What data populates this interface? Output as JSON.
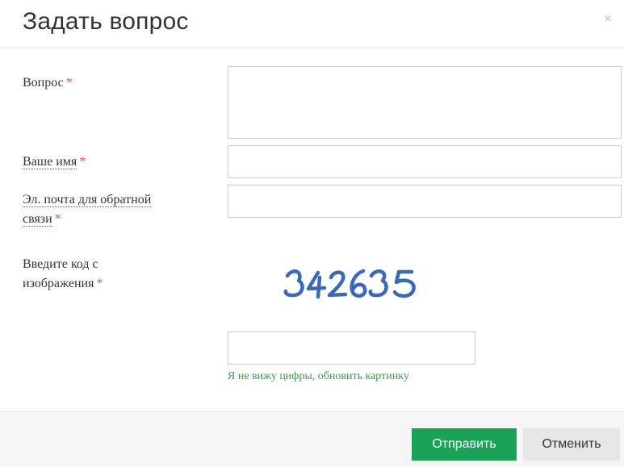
{
  "modal": {
    "title": "Задать вопрос",
    "close_icon": "×"
  },
  "form": {
    "question": {
      "label": "Вопрос",
      "required_mark": "*",
      "value": ""
    },
    "name": {
      "label": "Ваше имя",
      "required_mark": "*",
      "value": ""
    },
    "email": {
      "label_line1": "Эл. почта для обратной",
      "label_line2": "связи",
      "required_mark": "*",
      "value": ""
    },
    "captcha": {
      "label_line1": "Введите код с",
      "label_line2": "изображения",
      "required_mark": "*",
      "image_code": "342635",
      "value": "",
      "refresh_link": "Я не вижу цифры, обновить картинку"
    }
  },
  "footer": {
    "submit_label": "Отправить",
    "cancel_label": "Отменить"
  },
  "colors": {
    "accent_green": "#1aa358",
    "link_green": "#3a9b4e",
    "required_red": "#d9534f",
    "captcha_blue": "#3d68b8"
  }
}
